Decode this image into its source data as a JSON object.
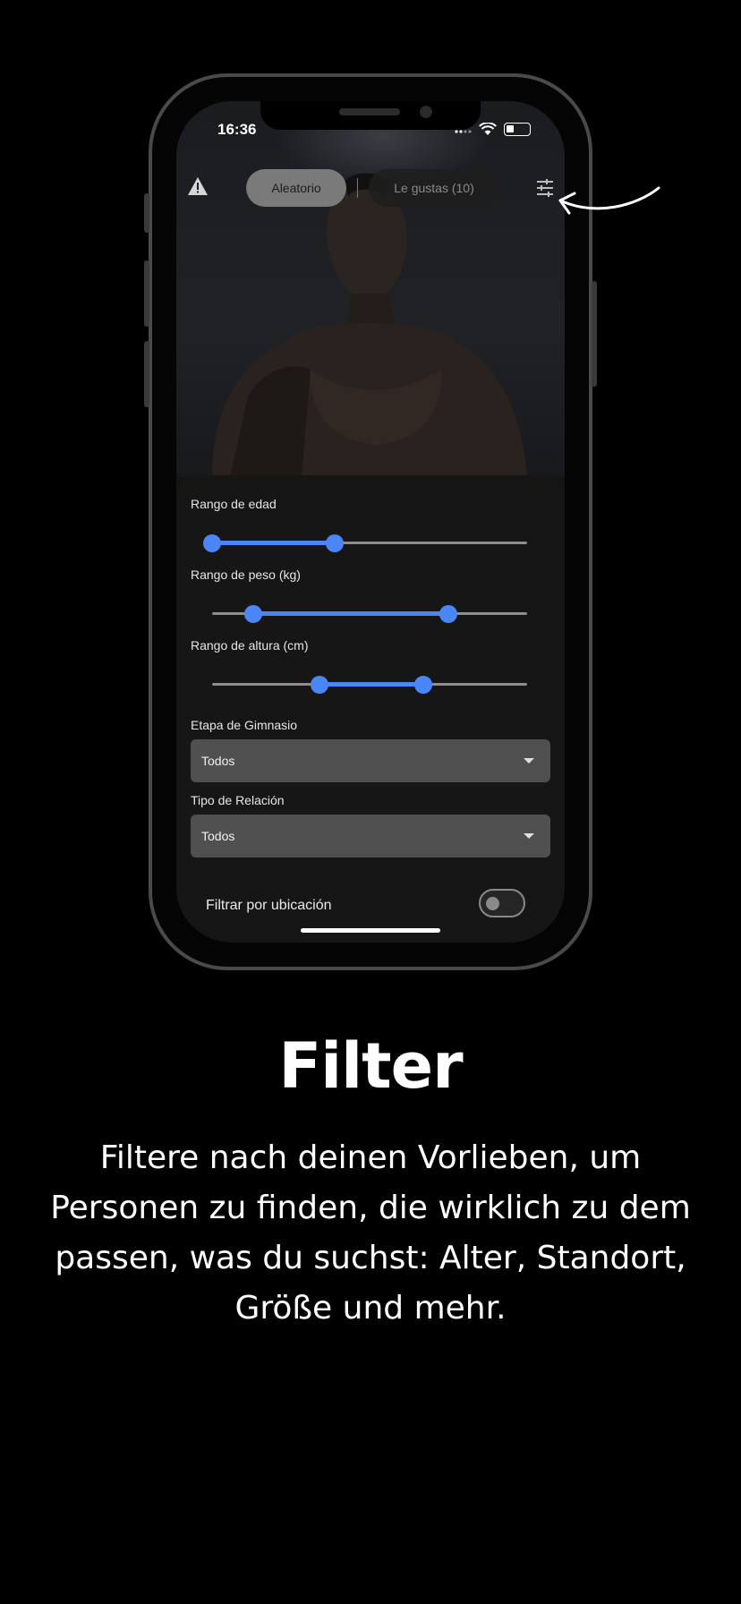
{
  "status_bar": {
    "time": "16:36"
  },
  "topbar": {
    "tab_random": "Aleatorio",
    "tab_likes": "Le gustas (10)",
    "icons": [
      "warning-icon",
      "filter-sliders-icon"
    ]
  },
  "filters": {
    "age_label": "Rango de edad",
    "age_range": {
      "low": 0.0,
      "high": 0.39
    },
    "weight_label": "Rango de peso (kg)",
    "weight_range": {
      "low": 0.13,
      "high": 0.75
    },
    "height_label": "Rango de altura (cm)",
    "height_range": {
      "low": 0.34,
      "high": 0.67
    },
    "gym_stage_label": "Etapa de Gimnasio",
    "gym_stage_value": "Todos",
    "relation_label": "Tipo de Relación",
    "relation_value": "Todos",
    "location_label": "Filtrar por ubicación",
    "location_enabled": false
  },
  "colors": {
    "accent": "#4a86f5",
    "background": "#000000",
    "panel": "#161616"
  },
  "promo": {
    "headline": "Filter",
    "description": "Filtere nach deinen Vorlieben, um Personen zu finden, die wirklich zu dem passen, was du suchst: Alter, Standort, Größe und mehr."
  }
}
